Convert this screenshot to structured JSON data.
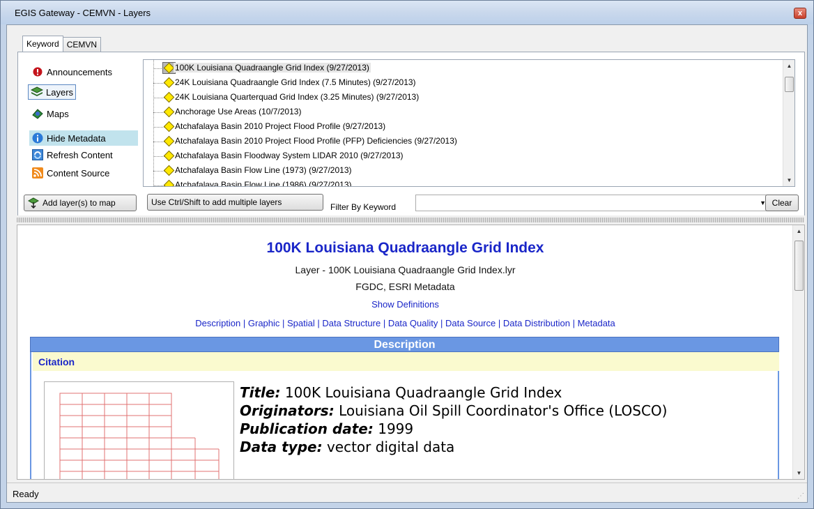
{
  "window": {
    "title": "EGIS Gateway - CEMVN - Layers",
    "close_glyph": "x"
  },
  "tabs": [
    {
      "label": "Keyword"
    },
    {
      "label": "CEMVN"
    }
  ],
  "nav": {
    "announcements": "Announcements",
    "layers": "Layers",
    "maps": "Maps",
    "hide_metadata": "Hide Metadata",
    "refresh_content": "Refresh Content",
    "content_source": "Content Source"
  },
  "layers_list": [
    "100K Louisiana Quadraangle Grid Index (9/27/2013)",
    "24K Louisiana Quadraangle Grid Index (7.5 Minutes) (9/27/2013)",
    "24K Louisiana Quarterquad Grid Index (3.25 Minutes) (9/27/2013)",
    "Anchorage Use Areas (10/7/2013)",
    "Atchafalaya Basin 2010 Project Flood Profile (9/27/2013)",
    "Atchafalaya Basin 2010 Project Flood Profile (PFP) Deficiencies (9/27/2013)",
    "Atchafalaya Basin Floodway System LIDAR 2010 (9/27/2013)",
    "Atchafalaya Basin Flow Line (1973) (9/27/2013)",
    "Atchafalaya Basin Flow Line (1986) (9/27/2013)"
  ],
  "toolbar": {
    "add_layers": "Add layer(s) to map",
    "ctrl_shift_hint": "Use Ctrl/Shift to add multiple layers",
    "filter_label": "Filter By Keyword",
    "filter_value": "",
    "clear": "Clear"
  },
  "metadata": {
    "title": "100K Louisiana Quadraangle Grid Index",
    "layer_file": "Layer - 100K Louisiana Quadraangle Grid Index.lyr",
    "metadata_types": "FGDC, ESRI Metadata",
    "show_definitions": "Show Definitions",
    "sections": [
      "Description",
      "Graphic",
      "Spatial",
      "Data Structure",
      "Data Quality",
      "Data Source",
      "Data Distribution",
      "Metadata"
    ],
    "section_header": "Description",
    "citation_header": "Citation",
    "citation": {
      "title_label": "Title:",
      "title_value": "100K Louisiana Quadraangle Grid Index",
      "originators_label": "Originators:",
      "originators_value": "Louisiana Oil Spill Coordinator's Office (LOSCO)",
      "pubdate_label": "Publication date:",
      "pubdate_value": "1999",
      "datatype_label": "Data type:",
      "datatype_value": "vector digital data"
    }
  },
  "status": {
    "text": "Ready"
  },
  "colors": {
    "link_blue": "#1a26c8",
    "section_blue": "#6a97e3",
    "citation_yellow": "#fafacf",
    "grid_red": "#e07070"
  }
}
